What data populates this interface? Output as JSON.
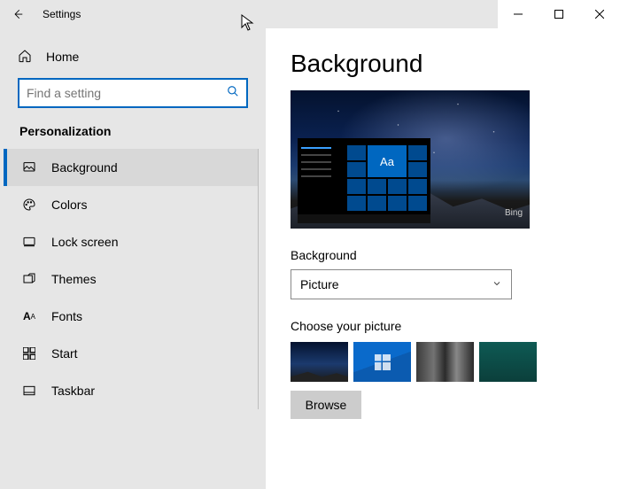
{
  "window": {
    "title": "Settings"
  },
  "sidebar": {
    "home_label": "Home",
    "search_placeholder": "Find a setting",
    "section_label": "Personalization",
    "items": [
      {
        "label": "Background",
        "icon": "picture-icon",
        "active": true
      },
      {
        "label": "Colors",
        "icon": "palette-icon",
        "active": false
      },
      {
        "label": "Lock screen",
        "icon": "lockscreen-icon",
        "active": false
      },
      {
        "label": "Themes",
        "icon": "themes-icon",
        "active": false
      },
      {
        "label": "Fonts",
        "icon": "fonts-icon",
        "active": false
      },
      {
        "label": "Start",
        "icon": "start-icon",
        "active": false
      },
      {
        "label": "Taskbar",
        "icon": "taskbar-icon",
        "active": false
      }
    ]
  },
  "page": {
    "title": "Background",
    "preview_sample_text": "Aa",
    "preview_watermark": "Bing",
    "background_label": "Background",
    "background_type": "Picture",
    "choose_label": "Choose your picture",
    "browse_label": "Browse"
  }
}
